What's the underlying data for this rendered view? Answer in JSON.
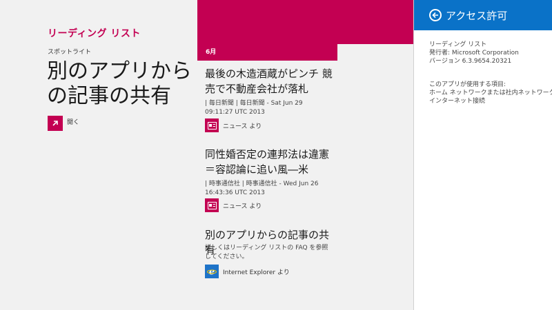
{
  "app": {
    "title": "リーディング リスト"
  },
  "spotlight": {
    "label": "スポットライト",
    "title": "別のアプリからの記事の共有",
    "open_label": "開く",
    "icon": "arrow-up-right-icon"
  },
  "articles": {
    "month": "6月",
    "items": [
      {
        "title": "最後の木造酒蔵がピンチ 競売で不動産会社が落札",
        "meta": "| 毎日新聞 | 毎日新聞 - Sat Jun 29 09:11:27 UTC 2013",
        "source": "ニュース より",
        "icon": "news-app-icon"
      },
      {
        "title": "同性婚否定の連邦法は違憲＝容認論に追い風―米",
        "meta": "| 時事通信社 | 時事通信社 - Wed Jun 26 16:43:36 UTC 2013",
        "source": "ニュース より",
        "icon": "news-app-icon"
      },
      {
        "title": "別のアプリからの記事の共有",
        "meta": "詳しくはリーディング リストの FAQ を参照してください。",
        "source": "Internet Explorer より",
        "icon": "internet-explorer-icon"
      }
    ]
  },
  "permissions": {
    "title": "アクセス許可",
    "app_name": "リーディング リスト",
    "publisher": "発行者: Microsoft Corporation",
    "version": "バージョン 6.3.9654.20321",
    "uses_label": "このアプリが使用する項目:",
    "uses": [
      "ホーム ネットワークまたは社内ネットワーク",
      "インターネット接続"
    ]
  },
  "colors": {
    "accent": "#c30052",
    "charm": "#0a72c8",
    "ie": "#1e73c8"
  }
}
